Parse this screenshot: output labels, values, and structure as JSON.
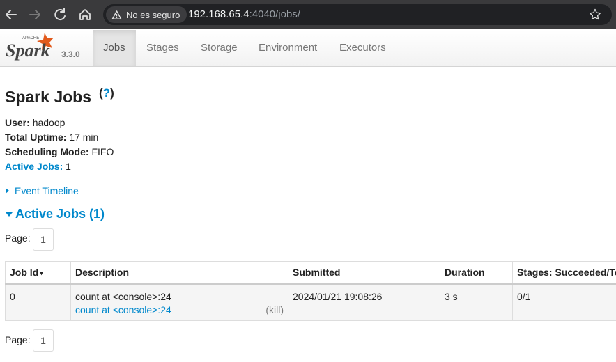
{
  "browser": {
    "security_label": "No es seguro",
    "url_host": "192.168.65.4",
    "url_rest": ":4040/jobs/"
  },
  "navbar": {
    "logo_text": "Spark",
    "logo_small": "APACHE",
    "version": "3.3.0",
    "tabs": [
      "Jobs",
      "Stages",
      "Storage",
      "Environment",
      "Executors"
    ],
    "active_tab": "Jobs"
  },
  "page": {
    "title": "Spark Jobs",
    "help": "?",
    "user_label": "User:",
    "user": "hadoop",
    "uptime_label": "Total Uptime:",
    "uptime": "17 min",
    "scheduling_label": "Scheduling Mode:",
    "scheduling": "FIFO",
    "active_jobs_label": "Active Jobs:",
    "active_jobs": "1",
    "event_timeline": "Event Timeline",
    "active_section": "Active Jobs (1)",
    "page_label": "Page:",
    "page_number": "1"
  },
  "table": {
    "headers": [
      "Job Id",
      "Description",
      "Submitted",
      "Duration",
      "Stages: Succeeded/Total"
    ],
    "sort_indicator": "▾",
    "rows": [
      {
        "job_id": "0",
        "description": "count at <console>:24",
        "description_link": "count at <console>:24",
        "kill": "(kill)",
        "submitted": "2024/01/21 19:08:26",
        "duration": "3 s",
        "stages": "0/1"
      }
    ]
  },
  "colors": {
    "link": "#0088cc",
    "chrome": "#3a3a3c",
    "spark_orange": "#e25a1c"
  }
}
